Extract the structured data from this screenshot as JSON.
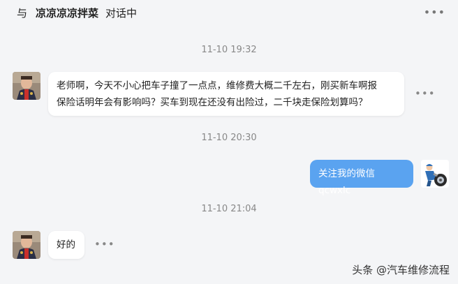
{
  "header": {
    "prefix": "与",
    "contact_name": "凉凉凉凉拌菜",
    "suffix": "对话中",
    "more_icon": "more-horizontal-icon"
  },
  "messages": [
    {
      "timestamp": "11-10 19:32",
      "side": "left",
      "line1": "老师啊，今天不小心把车子撞了一点点，维修费大概二千左右，刚买新车啊报",
      "line2": "保险话明年会有影响吗？买车到现在还没有出险过，二千块走保险划算吗？"
    },
    {
      "timestamp": "11-10 20:30",
      "side": "right",
      "text": "关注我的微信qcwxlc"
    },
    {
      "timestamp": "11-10 21:04",
      "side": "left",
      "text": "好的"
    }
  ],
  "watermark": "头条 @汽车维修流程",
  "colors": {
    "background": "#f4f5f7",
    "incoming_bubble": "#ffffff",
    "outgoing_bubble": "#5aa3f0"
  }
}
